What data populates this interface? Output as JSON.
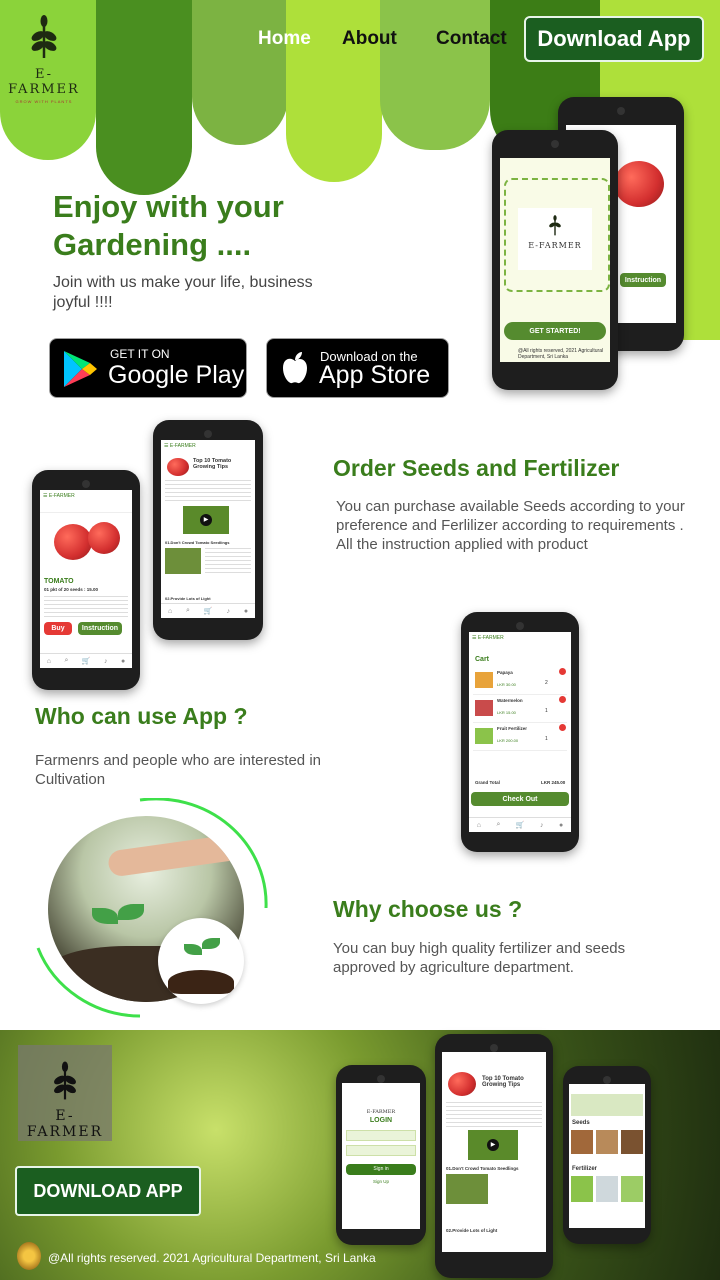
{
  "brand": {
    "name": "E-FARMER",
    "tagline": "GROW WITH PLANTS"
  },
  "nav": {
    "home": "Home",
    "about": "About",
    "contact": "Contact",
    "download": "Download App"
  },
  "hero": {
    "title_line1": "Enjoy with your",
    "title_line2": "Gardening ....",
    "subtitle": "Join with us make your life, business joyful !!!!"
  },
  "stores": {
    "google_small": "GET IT ON",
    "google_big": "Google Play",
    "apple_small": "Download on the",
    "apple_big": "App Store"
  },
  "phone_splash": {
    "get_started": "GET STARTED!",
    "rights": "@All rights reserved, 2021 Agricultural Department, Sri Lanka",
    "instruction": "Instruction"
  },
  "phone_product": {
    "name": "TOMATO",
    "price": "01 pkt of 20 seeds : 15.00",
    "buy": "Buy",
    "instruction": "Instruction"
  },
  "phone_article": {
    "title": "Top 10 Tomato Growing Tips",
    "item1": "01.Don't Crowd Tomato Seedlings",
    "item2": "02.Provide Lots of Light"
  },
  "sections": {
    "order": {
      "title": "Order  Seeds and Fertilizer",
      "text": "You can purchase available Seeds according to your preference and Ferlilizer according to requirements . All the instruction applied with product"
    },
    "who": {
      "title": "Who can use App ?",
      "text": "Farmenrs and people who are interested in Cultivation"
    },
    "why": {
      "title": "Why choose us ?",
      "text": "You can buy high quality fertilizer and seeds approved by agriculture department."
    }
  },
  "cart": {
    "title": "Cart",
    "items": [
      {
        "name": "Papaya",
        "price": "LKR 30.00",
        "qty": "2"
      },
      {
        "name": "Watermelon",
        "price": "LKR 15.00",
        "qty": "1"
      },
      {
        "name": "Fruit Fertilizer",
        "price": "LKR 200.00",
        "qty": "1"
      }
    ],
    "grand_label": "Grand Total",
    "grand_value": "LKR 245.00",
    "checkout": "Check Out"
  },
  "login": {
    "title": "LOGIN",
    "signin": "Sign in",
    "signup": "Sign Up"
  },
  "shop": {
    "seeds": "Seeds",
    "fertilizer": "Fertilizer"
  },
  "footer": {
    "download": "DOWNLOAD APP",
    "copyright": "@All rights reserved. 2021 Agricultural Department, Sri Lanka"
  },
  "colors": {
    "primary_green": "#3a7d1c",
    "dark_green": "#1b5e20",
    "lime": "#8bc34a",
    "light_lime": "#aee03a"
  }
}
